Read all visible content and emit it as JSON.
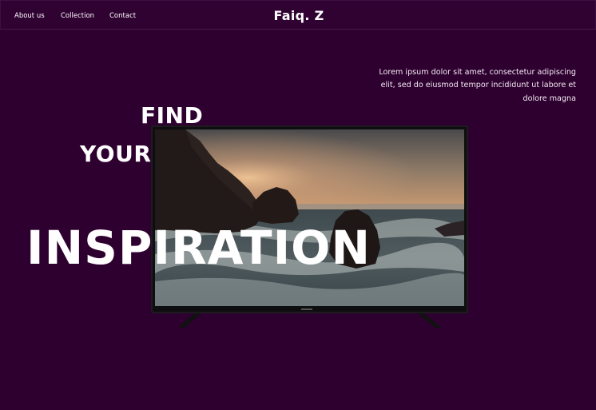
{
  "nav": {
    "links": [
      "About us",
      "Collection",
      "Contact"
    ],
    "brand": "Faiq. Z"
  },
  "hero": {
    "description": "Lorem ipsum dolor sit amet, consectetur adipiscing elit, sed do eiusmod tempor incididunt ut labore et dolore magna",
    "headline": {
      "line1": "FIND",
      "line2": "YOUR",
      "line3": "INSPIRATION"
    }
  },
  "colors": {
    "background": "#2e0030",
    "text": "#ffffff"
  }
}
